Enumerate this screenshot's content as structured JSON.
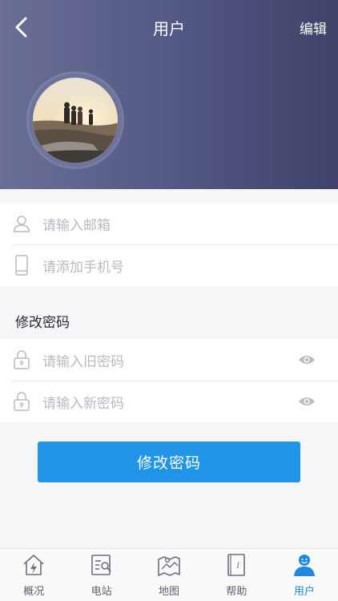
{
  "header": {
    "title": "用户",
    "edit_label": "编辑",
    "back_icon": "chevron-left-icon"
  },
  "contact": {
    "email_placeholder": "请输入邮箱",
    "phone_placeholder": "请添加手机号"
  },
  "password": {
    "section_title": "修改密码",
    "old_placeholder": "请输入旧密码",
    "new_placeholder": "请输入新密码",
    "submit_label": "修改密码"
  },
  "tabbar": {
    "active_color": "#1f88e0",
    "items": [
      {
        "label": "概况",
        "icon": "house-bolt-icon"
      },
      {
        "label": "电站",
        "icon": "station-search-icon"
      },
      {
        "label": "地图",
        "icon": "map-icon"
      },
      {
        "label": "帮助",
        "icon": "help-book-icon"
      },
      {
        "label": "用户",
        "icon": "user-icon",
        "active": true
      }
    ]
  },
  "colors": {
    "header_left": "#6a6f97",
    "header_right": "#3f4269",
    "button": "#2094e6"
  }
}
